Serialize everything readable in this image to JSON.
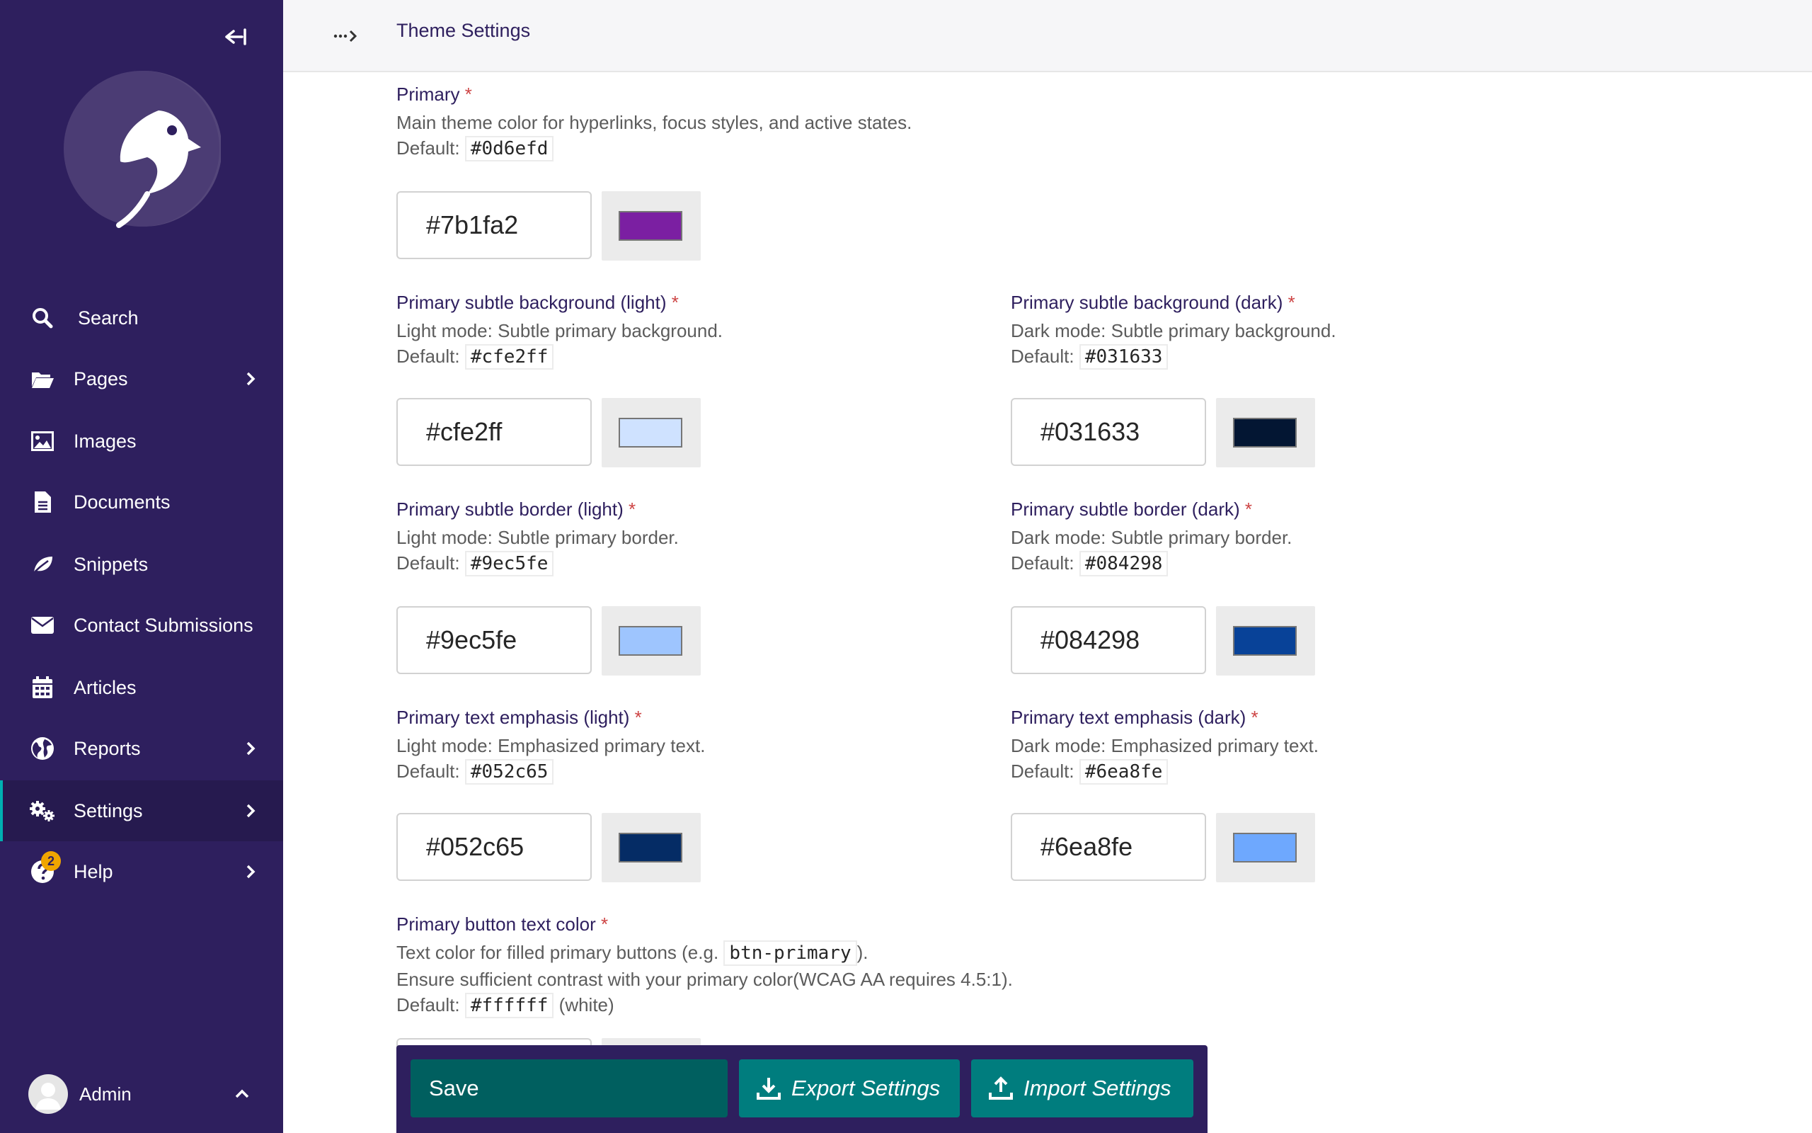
{
  "header": {
    "title": "Theme Settings"
  },
  "sidebar": {
    "items": [
      {
        "label": "Search"
      },
      {
        "label": "Pages"
      },
      {
        "label": "Images"
      },
      {
        "label": "Documents"
      },
      {
        "label": "Snippets"
      },
      {
        "label": "Contact Submissions"
      },
      {
        "label": "Articles"
      },
      {
        "label": "Reports"
      },
      {
        "label": "Settings"
      },
      {
        "label": "Help",
        "badge": "2"
      }
    ],
    "account": {
      "name": "Admin"
    }
  },
  "fields": {
    "primary": {
      "label": "Primary",
      "required": "*",
      "help": "Main theme color for hyperlinks, focus styles, and active states.",
      "default_label": "Default:",
      "default": "#0d6efd",
      "value": "#7b1fa2",
      "color": "#7b1fa2"
    },
    "subtle_bg_light": {
      "label": "Primary subtle background (light)",
      "required": "*",
      "help": "Light mode: Subtle primary background.",
      "default_label": "Default:",
      "default": "#cfe2ff",
      "value": "#cfe2ff",
      "color": "#cfe2ff"
    },
    "subtle_bg_dark": {
      "label": "Primary subtle background (dark)",
      "required": "*",
      "help": "Dark mode: Subtle primary background.",
      "default_label": "Default:",
      "default": "#031633",
      "value": "#031633",
      "color": "#031633"
    },
    "subtle_border_light": {
      "label": "Primary subtle border (light)",
      "required": "*",
      "help": "Light mode: Subtle primary border.",
      "default_label": "Default:",
      "default": "#9ec5fe",
      "value": "#9ec5fe",
      "color": "#9ec5fe"
    },
    "subtle_border_dark": {
      "label": "Primary subtle border (dark)",
      "required": "*",
      "help": "Dark mode: Subtle primary border.",
      "default_label": "Default:",
      "default": "#084298",
      "value": "#084298",
      "color": "#084298"
    },
    "text_emphasis_light": {
      "label": "Primary text emphasis (light)",
      "required": "*",
      "help": "Light mode: Emphasized primary text.",
      "default_label": "Default:",
      "default": "#052c65",
      "value": "#052c65",
      "color": "#052c65"
    },
    "text_emphasis_dark": {
      "label": "Primary text emphasis (dark)",
      "required": "*",
      "help": "Dark mode: Emphasized primary text.",
      "default_label": "Default:",
      "default": "#6ea8fe",
      "value": "#6ea8fe",
      "color": "#6ea8fe"
    },
    "button_text": {
      "label": "Primary button text color",
      "required": "*",
      "help_prefix": "Text color for filled primary buttons (e.g.",
      "help_code": "btn-primary",
      "help_suffix": ").",
      "help2": "Ensure sufficient contrast with your primary color(WCAG AA requires 4.5:1).",
      "default_label": "Default:",
      "default": "#ffffff",
      "default_note": "(white)"
    }
  },
  "actions": {
    "save": "Save",
    "export": "Export Settings",
    "import": "Import Settings"
  }
}
